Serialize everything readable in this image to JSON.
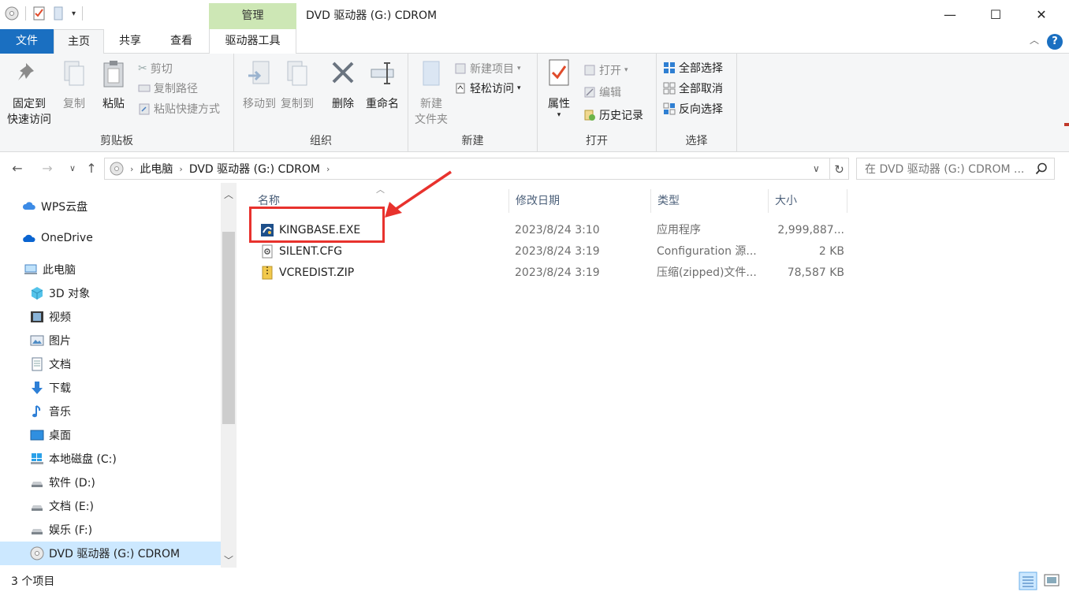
{
  "window": {
    "title": "DVD 驱动器 (G:) CDROM",
    "manage_tab": "管理",
    "minimize": "—",
    "maximize": "☐",
    "close": "✕"
  },
  "tabs": {
    "file": "文件",
    "home": "主页",
    "share": "共享",
    "view": "查看",
    "drive_tools": "驱动器工具"
  },
  "ribbon": {
    "clipboard": {
      "label": "剪贴板",
      "pin_line1": "固定到",
      "pin_line2": "快速访问",
      "copy": "复制",
      "paste": "粘贴",
      "cut": "剪切",
      "copy_path": "复制路径",
      "paste_shortcut": "粘贴快捷方式"
    },
    "organize": {
      "label": "组织",
      "move_to": "移动到",
      "copy_to": "复制到",
      "delete": "删除",
      "rename": "重命名"
    },
    "new": {
      "label": "新建",
      "new_folder_line1": "新建",
      "new_folder_line2": "文件夹",
      "new_item": "新建项目",
      "easy_access": "轻松访问"
    },
    "open": {
      "label": "打开",
      "properties": "属性",
      "open": "打开",
      "edit": "编辑",
      "history": "历史记录"
    },
    "select": {
      "label": "选择",
      "select_all": "全部选择",
      "select_none": "全部取消",
      "invert": "反向选择"
    }
  },
  "address": {
    "crumbs": [
      "此电脑",
      "DVD 驱动器 (G:) CDROM"
    ],
    "search_placeholder": "在 DVD 驱动器 (G:) CDROM ..."
  },
  "nav": [
    {
      "label": "WPS云盘",
      "icon": "cloud-icon"
    },
    {
      "label": "OneDrive",
      "icon": "onedrive-icon"
    },
    {
      "label": "此电脑",
      "icon": "computer-icon"
    },
    {
      "label": "3D 对象",
      "icon": "cube-icon"
    },
    {
      "label": "视频",
      "icon": "video-icon"
    },
    {
      "label": "图片",
      "icon": "picture-icon"
    },
    {
      "label": "文档",
      "icon": "document-icon"
    },
    {
      "label": "下载",
      "icon": "download-icon"
    },
    {
      "label": "音乐",
      "icon": "music-icon"
    },
    {
      "label": "桌面",
      "icon": "desktop-icon"
    },
    {
      "label": "本地磁盘 (C:)",
      "icon": "windows-drive-icon"
    },
    {
      "label": "软件 (D:)",
      "icon": "drive-icon"
    },
    {
      "label": "文档 (E:)",
      "icon": "drive-icon"
    },
    {
      "label": "娱乐 (F:)",
      "icon": "drive-icon"
    },
    {
      "label": "DVD 驱动器 (G:) CDROM",
      "icon": "dvd-icon"
    }
  ],
  "columns": {
    "name": "名称",
    "modified": "修改日期",
    "type": "类型",
    "size": "大小"
  },
  "files": [
    {
      "name": "KINGBASE.EXE",
      "modified": "2023/8/24 3:10",
      "type": "应用程序",
      "size": "2,999,887...",
      "icon": "exe-icon"
    },
    {
      "name": "SILENT.CFG",
      "modified": "2023/8/24 3:19",
      "type": "Configuration 源...",
      "size": "2 KB",
      "icon": "config-file-icon"
    },
    {
      "name": "VCREDIST.ZIP",
      "modified": "2023/8/24 3:19",
      "type": "压缩(zipped)文件...",
      "size": "78,587 KB",
      "icon": "zip-icon"
    }
  ],
  "status": {
    "item_count": "3 个项目"
  },
  "colors": {
    "accent": "#1a6fc1",
    "manage_tab_bg": "#cde7b5",
    "selection": "#cce8ff",
    "annotation": "#e8322d"
  }
}
